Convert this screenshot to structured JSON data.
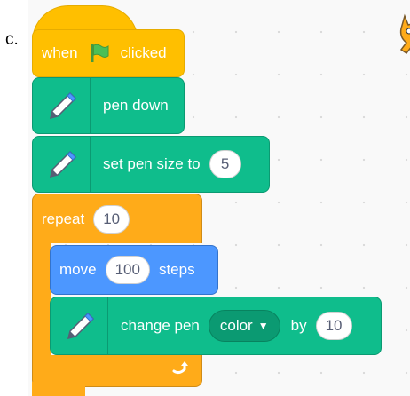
{
  "question_label": "c.",
  "hat": {
    "when_label": "when",
    "clicked_label": "clicked",
    "flag_icon": "green-flag-icon"
  },
  "pen_down": {
    "label": "pen down"
  },
  "set_pen_size": {
    "label": "set pen size to",
    "value": "5"
  },
  "repeat": {
    "label": "repeat",
    "count": "10"
  },
  "move": {
    "label_before": "move",
    "value": "100",
    "label_after": "steps"
  },
  "change_pen": {
    "label": "change pen",
    "dropdown": "color",
    "by_label": "by",
    "value": "10"
  },
  "colors": {
    "events": "#ffbf00",
    "pen": "#0fbd8c",
    "control": "#ffab19",
    "motion": "#4c97ff"
  }
}
